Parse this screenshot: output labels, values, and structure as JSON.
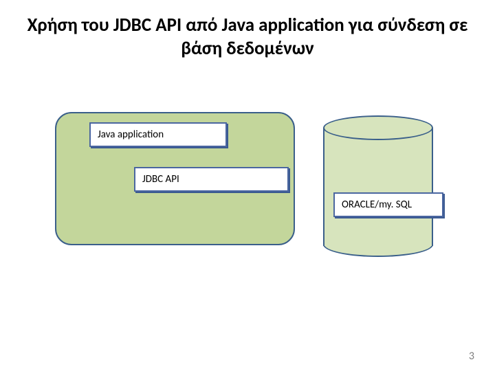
{
  "title": "Χρήση του JDBC API από Java application για σύνδεση σε βάση δεδομένων",
  "boxes": {
    "javaApp": "Java application",
    "jdbcApi": "JDBC API",
    "oracle": "ORACLE/my. SQL"
  },
  "pageNumber": "3"
}
